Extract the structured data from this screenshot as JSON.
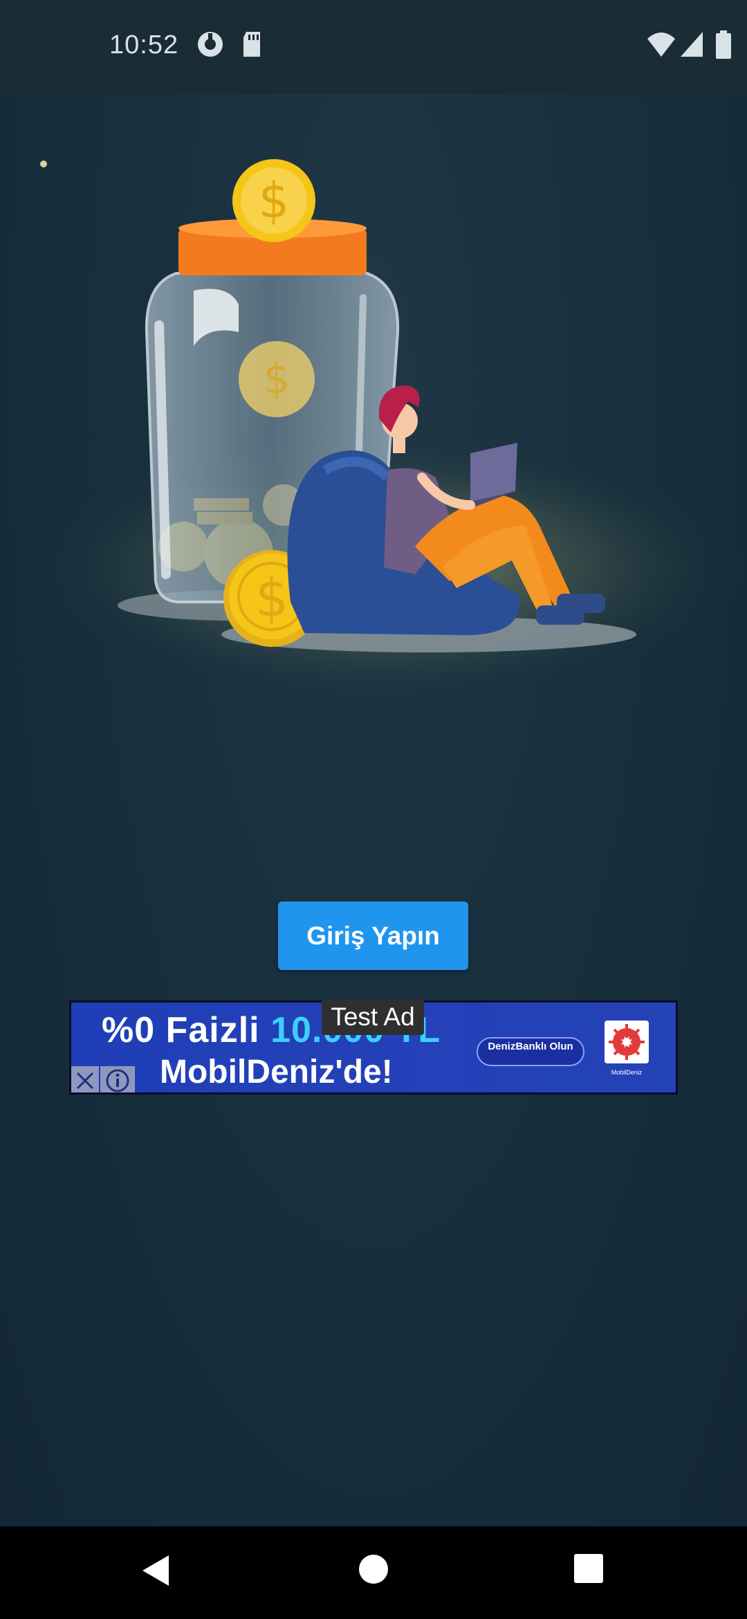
{
  "status_bar": {
    "time": "10:52",
    "icons": [
      "vpn-key-icon",
      "sd-card-icon",
      "wifi-icon",
      "signal-icon",
      "battery-icon"
    ]
  },
  "main": {
    "login_button_label": "Giriş Yapın"
  },
  "ad": {
    "test_label": "Test Ad",
    "line1_prefix": "%0 Faizli ",
    "line1_amount": "10.000 TL",
    "line2": "MobilDeniz'de!",
    "cta": "DenizBanklı Olun",
    "logo_caption": "MobilDeniz"
  },
  "nav_bar": {
    "buttons": [
      "back-icon",
      "home-icon",
      "recents-icon"
    ]
  },
  "colors": {
    "background": "#152836",
    "button": "#1f95ee",
    "ad_blue": "#2540b8",
    "coin": "#f5c518"
  }
}
